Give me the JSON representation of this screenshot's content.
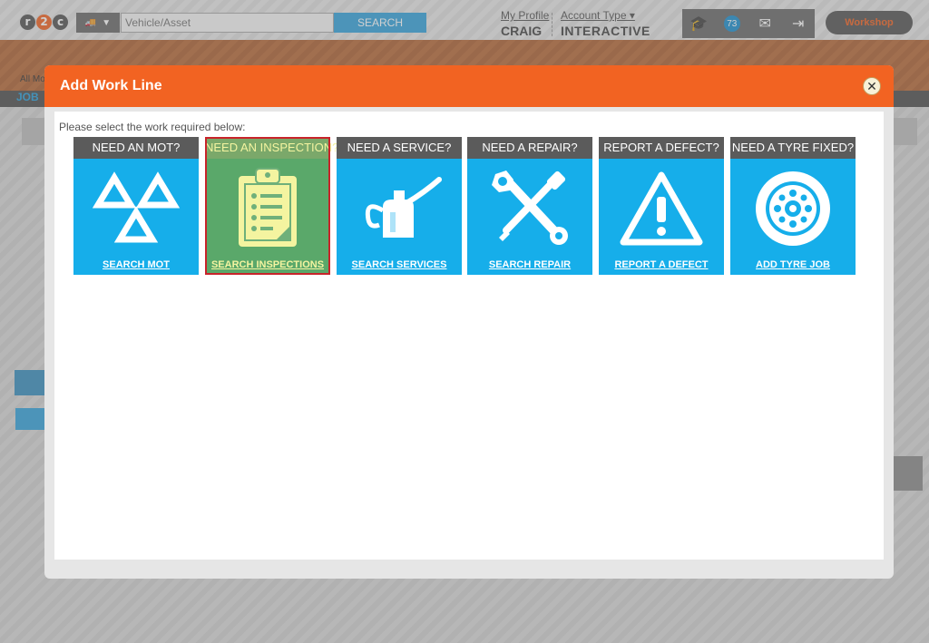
{
  "header": {
    "logo_letters": [
      "r",
      "2",
      "c"
    ],
    "search": {
      "placeholder": "Vehicle/Asset",
      "button_label": "SEARCH"
    },
    "profile": {
      "link_label": "My Profile",
      "user_name": "CRAIG"
    },
    "account": {
      "link_label": "Account Type",
      "type": "INTERACTIVE"
    },
    "icons": [
      "graduation-cap-icon",
      "badge-icon",
      "mail-icon",
      "logout-icon"
    ],
    "badge_count": "73",
    "workshop_label": "Workshop"
  },
  "nav": {
    "all_modules_label": "All Mo"
  },
  "subbar": {
    "label": "JOB"
  },
  "modal": {
    "title": "Add Work Line",
    "close_symbol": "✕",
    "instructions": "Please select the work required below:",
    "tiles": [
      {
        "heading": "NEED AN MOT?",
        "link": "SEARCH MOT",
        "icon": "mot-triangles-icon",
        "selected": false
      },
      {
        "heading": "NEED AN INSPECTION?",
        "link": "SEARCH INSPECTIONS",
        "icon": "clipboard-icon",
        "selected": true
      },
      {
        "heading": "NEED A SERVICE?",
        "link": "SEARCH SERVICES",
        "icon": "oil-can-icon",
        "selected": false
      },
      {
        "heading": "NEED A REPAIR?",
        "link": "SEARCH REPAIR",
        "icon": "tools-icon",
        "selected": false
      },
      {
        "heading": "REPORT A DEFECT?",
        "link": "REPORT A DEFECT",
        "icon": "warning-icon",
        "selected": false
      },
      {
        "heading": "NEED A TYRE FIXED?",
        "link": "ADD TYRE JOB",
        "icon": "tyre-icon",
        "selected": false
      }
    ]
  },
  "colors": {
    "accent_orange": "#f26322",
    "tile_blue": "#16aeea",
    "selected_green": "#5aa86a",
    "selected_border": "#c8232a"
  }
}
